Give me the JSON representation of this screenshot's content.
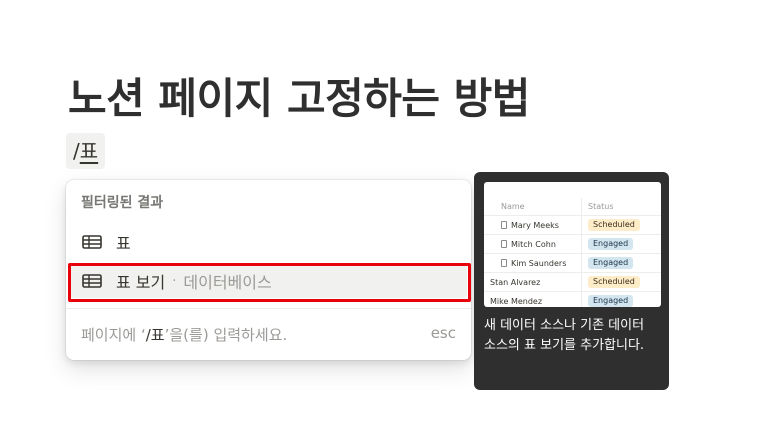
{
  "page": {
    "title": "노션 페이지 고정하는 방법"
  },
  "command": {
    "slash": "/",
    "query": "표"
  },
  "menu": {
    "header": "필터링된 결과",
    "items": [
      {
        "label": "표",
        "icon": "table-icon"
      },
      {
        "label": "표 보기",
        "separator": "·",
        "sublabel": "데이터베이스",
        "icon": "table-icon"
      }
    ],
    "footer": {
      "prefix": "페이지에 ‘",
      "query": "/표",
      "suffix": "’을(를) 입력하세요.",
      "esc": "esc"
    }
  },
  "tooltip": {
    "preview": {
      "columns": [
        "Name",
        "Status"
      ],
      "rows": [
        {
          "name": "Mary Meeks",
          "status": "Scheduled",
          "doc": true
        },
        {
          "name": "Mitch Cohn",
          "status": "Engaged",
          "doc": true
        },
        {
          "name": "Kim Saunders",
          "status": "Engaged",
          "doc": true
        },
        {
          "name": "Stan Alvarez",
          "status": "Scheduled",
          "doc": false
        },
        {
          "name": "Mike Mendez",
          "status": "Engaged",
          "doc": false
        }
      ]
    },
    "description": "새 데이터 소스나 기존 데이터 소스의 표 보기를 추가합니다."
  },
  "colors": {
    "highlight": "#e8000b",
    "tooltip_bg": "#2f2f2f",
    "scheduled_bg": "#fdecc8",
    "engaged_bg": "#d3e5ef"
  }
}
